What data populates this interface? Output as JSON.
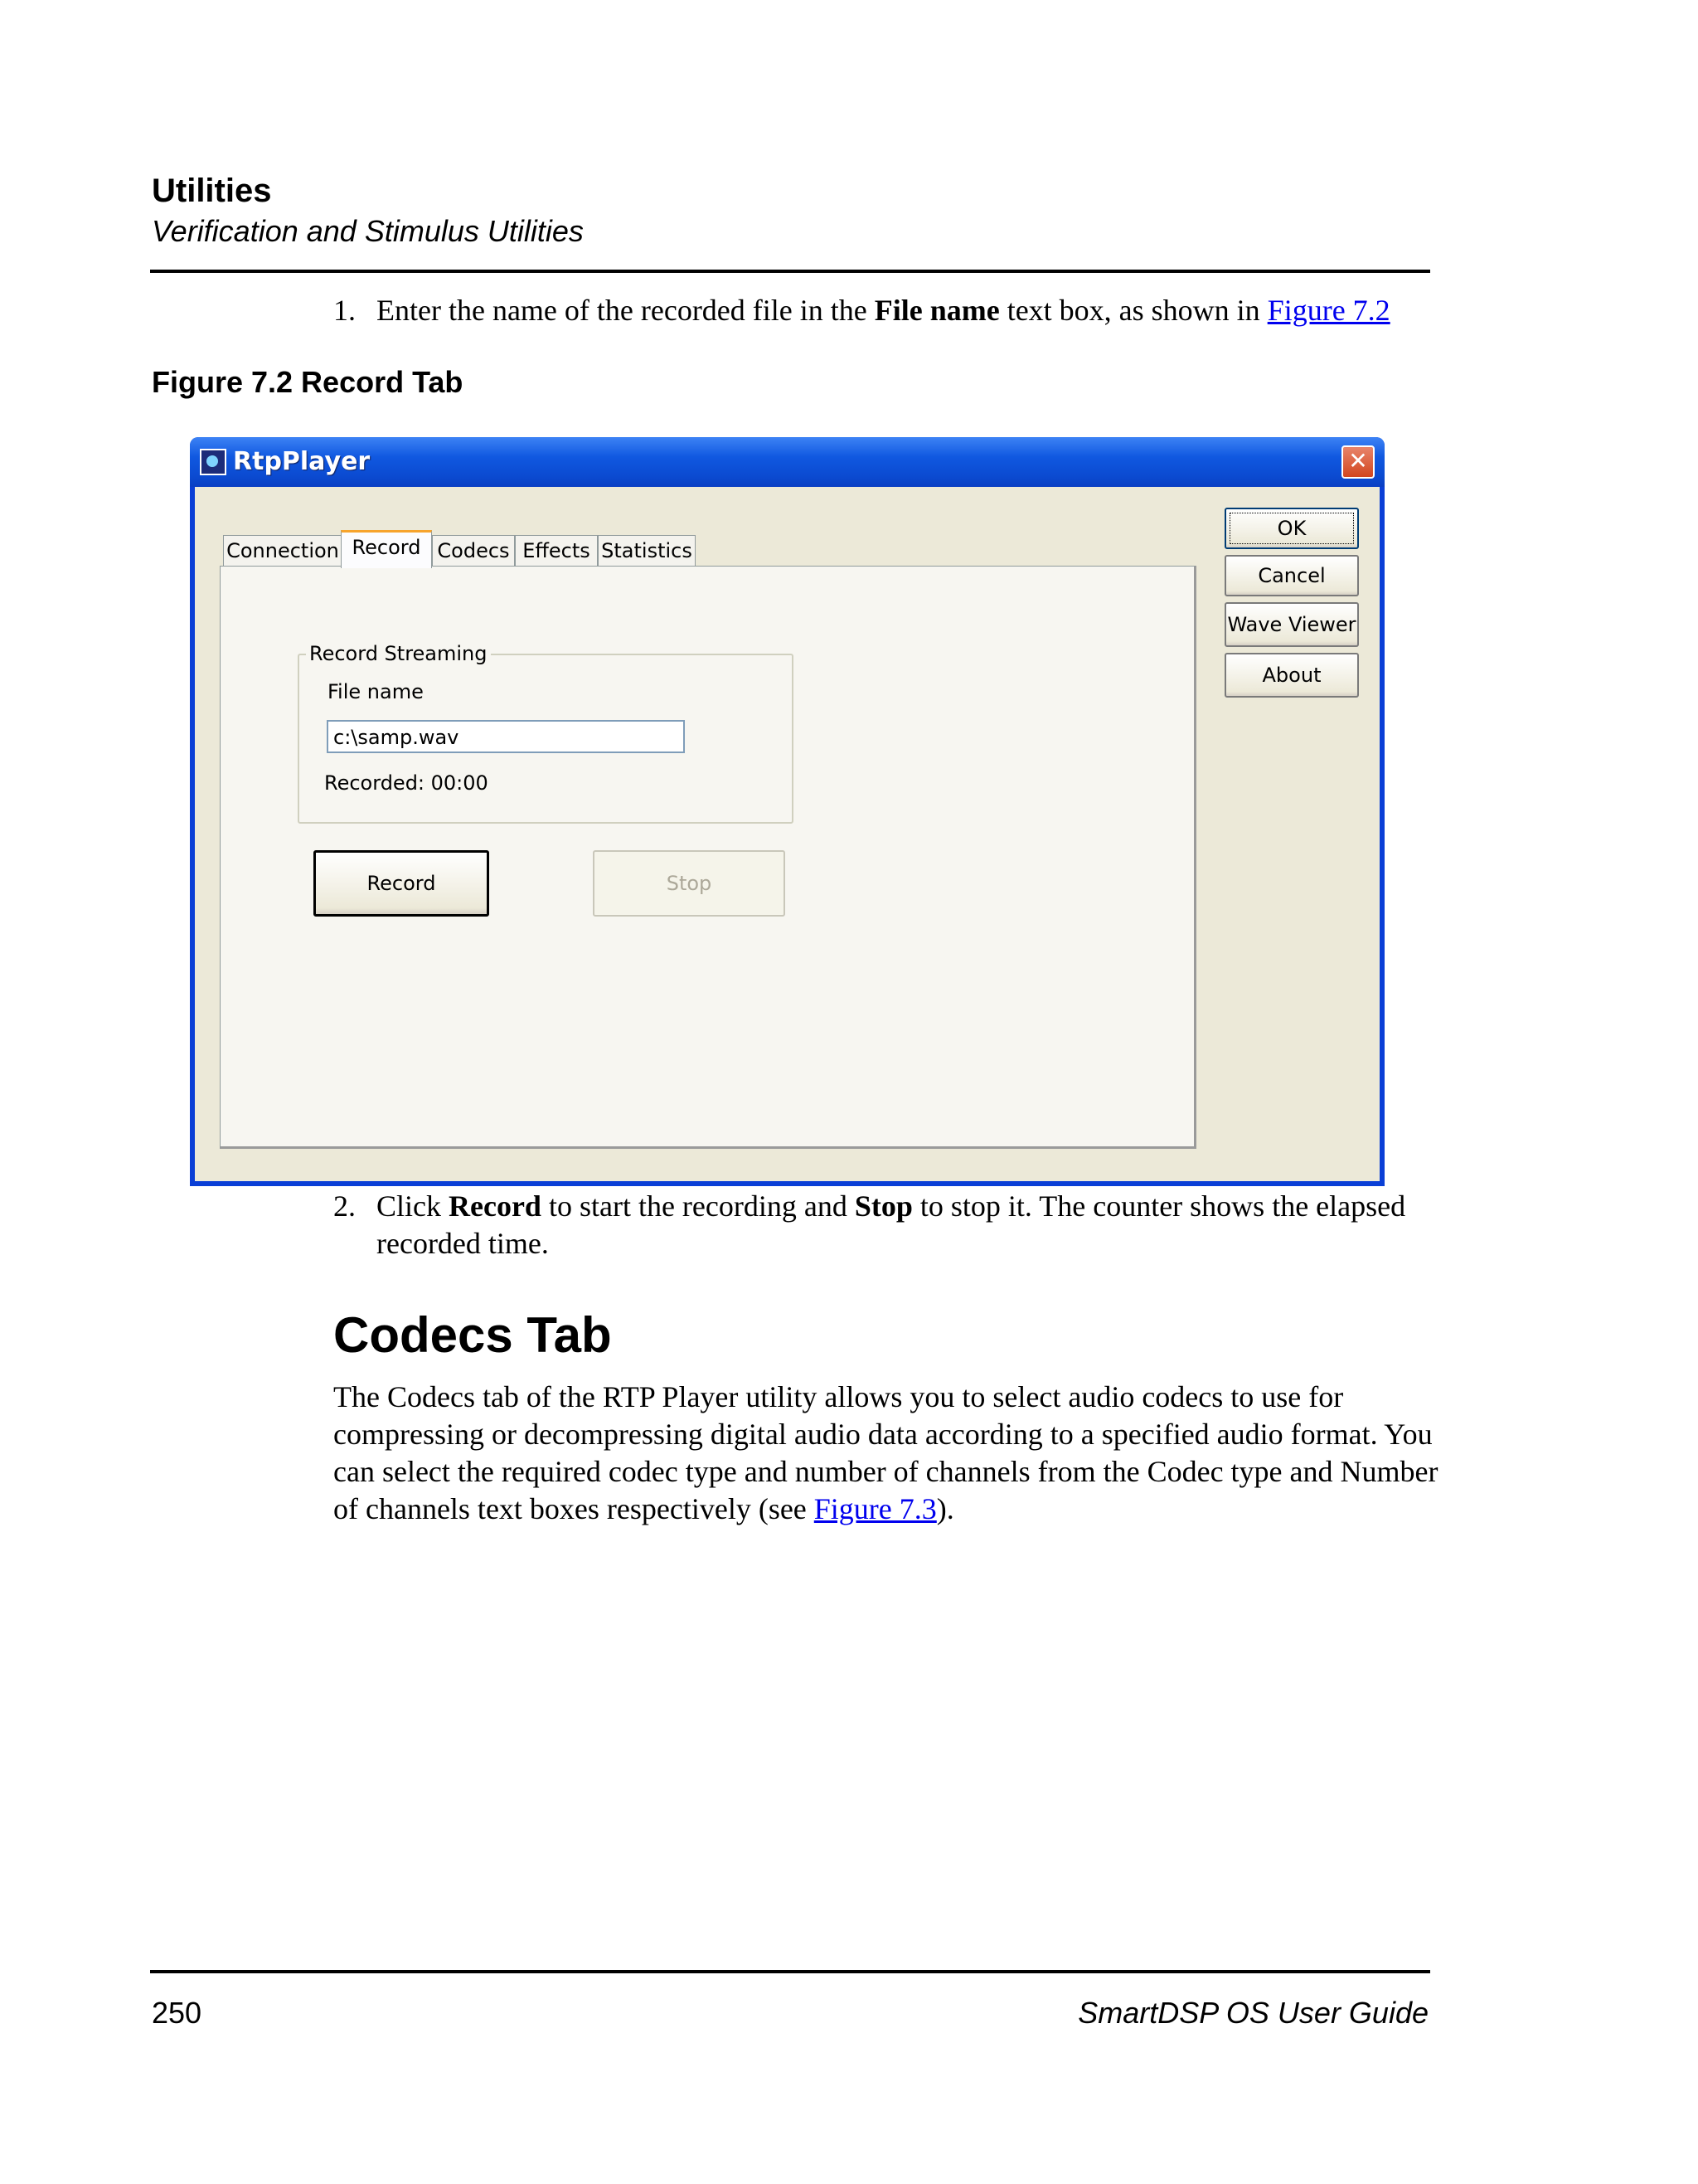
{
  "header": {
    "title": "Utilities",
    "subtitle": "Verification and Stimulus Utilities"
  },
  "step1": {
    "number": "1.",
    "text_before": "Enter the name of the recorded file in the ",
    "bold": "File name",
    "text_after": " text box, as shown in ",
    "link": "Figure 7.2"
  },
  "figure": {
    "caption": "Figure 7.2  Record Tab"
  },
  "window": {
    "title": "RtpPlayer",
    "close_glyph": "✕",
    "tabs": [
      "Connection",
      "Record",
      "Codecs",
      "Effects",
      "Statistics"
    ],
    "group_title": "Record Streaming",
    "file_name_label": "File name",
    "file_name_value": "c:\\samp.wav",
    "recorded_label": "Recorded: 00:00",
    "record_button": "Record",
    "stop_button": "Stop",
    "side_buttons": {
      "ok": "OK",
      "cancel": "Cancel",
      "wave_viewer": "Wave Viewer",
      "about": "About"
    }
  },
  "step2": {
    "number": "2.",
    "t1": "Click ",
    "b1": "Record",
    "t2": " to start the recording and ",
    "b2": "Stop",
    "t3": " to stop it. The counter shows the elapsed recorded time."
  },
  "section": {
    "heading": "Codecs Tab",
    "body": "The Codecs tab of the RTP Player utility allows you to select audio codecs to use for compressing or decompressing digital audio data according to a specified audio format. You can select the required codec type and number of channels from the Codec type and Number of channels text boxes respectively (see ",
    "link": "Figure 7.3",
    "body_end": ")."
  },
  "footer": {
    "page_number": "250",
    "guide_title": "SmartDSP OS User Guide"
  }
}
